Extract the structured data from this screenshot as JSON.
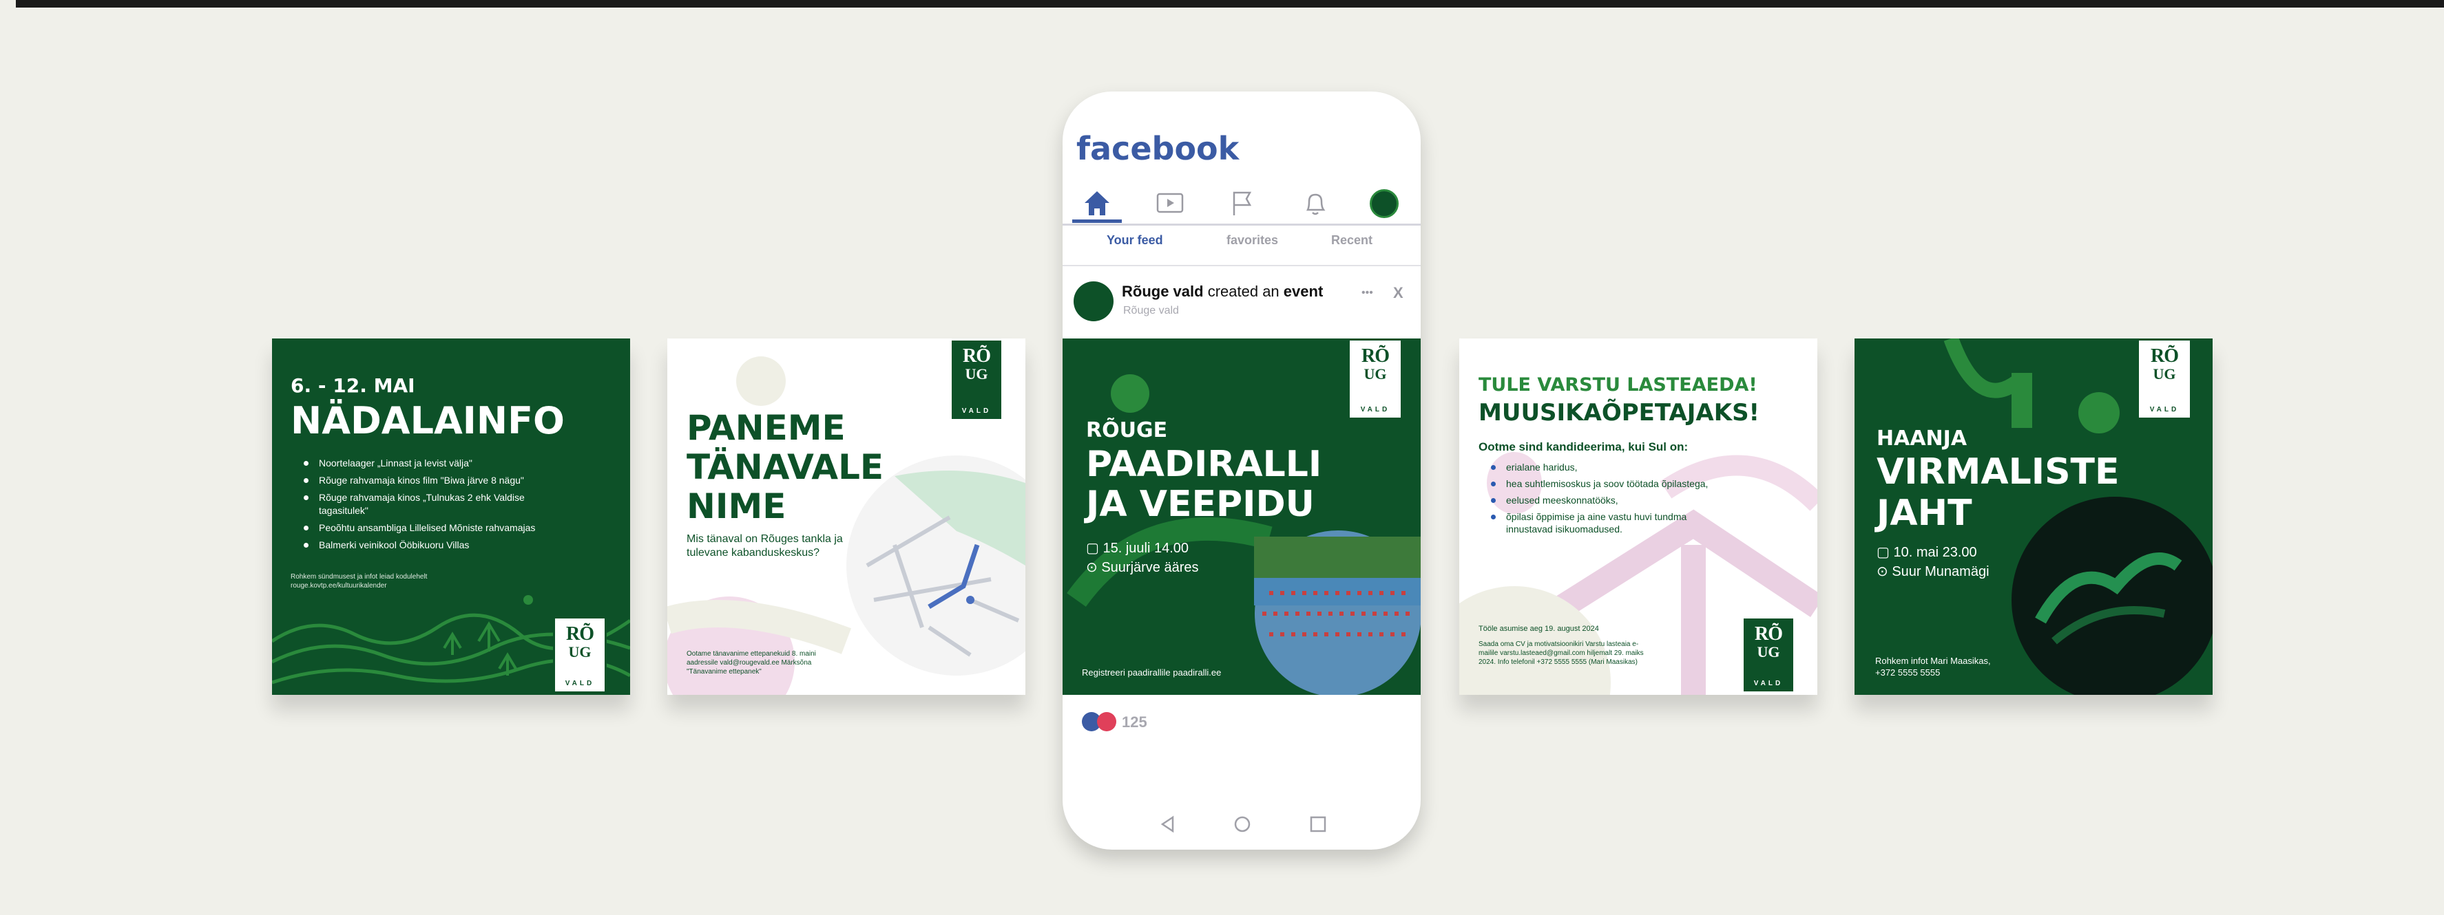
{
  "cards": {
    "nadalainfo": {
      "date": "6. - 12. MAI",
      "title": "NÄDALAINFO",
      "items": [
        "Noortelaager „Linnast ja levist välja\"",
        "Rõuge rahvamaja kinos film \"Biwa järve 8 nägu\"",
        "Rõuge rahvamaja kinos „Tulnukas 2 ehk Valdise tagasitulek\"",
        "Peoõhtu ansambliga Lillelised Mõniste rahvamajas",
        "Balmerki veinikool Ööbikuoru Villas"
      ],
      "footer": "Rohkem sündmusest ja infot leiad kodulehelt rouge.kovtp.ee/kultuurikalender"
    },
    "tanav": {
      "title": "PANEME TÄNAVALE NIME",
      "question": "Mis tänaval on Rõuges tankla ja tulevane kabanduskeskus?",
      "footer": "Ootame tänavanime ettepanekuid 8. maini aadressile vald@rougevald.ee Märksõna \"Tänavanime ettepanek\""
    },
    "lasteaed": {
      "line1": "TULE VARSTU LASTEAEDA!",
      "line2": "MUUSIKAÕPETAJAKS!",
      "intro": "Ootme sind kandideerima, kui Sul on:",
      "items": [
        "erialane haridus,",
        "hea suhtlemisoskus ja soov töötada õpilastega,",
        "eelused meeskonnatööks,",
        "õpilasi õppimise ja aine vastu huvi tundma innustavad isikuomadused."
      ],
      "start": "Tööle asumise aeg 19. august 2024",
      "contact": "Saada oma CV ja motivatsioonikiri Varstu lasteaia e-mailile varstu.lasteaed@gmail.com hiljemalt 29. maiks 2024. Info telefonil +372 5555 5555 (Mari Maasikas)"
    },
    "virmalised": {
      "place": "HAANJA",
      "title": "VIRMALISTE JAHT",
      "date": "10. mai 23.00",
      "location": "Suur Munamägi",
      "footer": "Rohkem infot Mari Maasikas, +372 5555 5555"
    }
  },
  "logo": {
    "r": "RÕ",
    "g": "UG",
    "word": "VALD"
  },
  "phone": {
    "brand": "facebook",
    "tabs": [
      "Your feed",
      "favorites",
      "Recent"
    ],
    "post": {
      "author": "Rõuge vald",
      "action": "created an",
      "object": "event",
      "sub": "Rõuge vald",
      "more": "•••",
      "close": "X"
    },
    "event": {
      "place": "RÕUGE",
      "title": "PAADIRALLI JA VEEPIDU",
      "date": "15. juuli 14.00",
      "location": "Suurjärve ääres",
      "register": "Registreeri paadirallile paadiralli.ee"
    },
    "reactions": "125"
  },
  "colors": {
    "green": "#0d5128",
    "accent": "#2a8a3c",
    "pink": "#e6c8dc",
    "fb_blue": "#3b5ba4"
  }
}
